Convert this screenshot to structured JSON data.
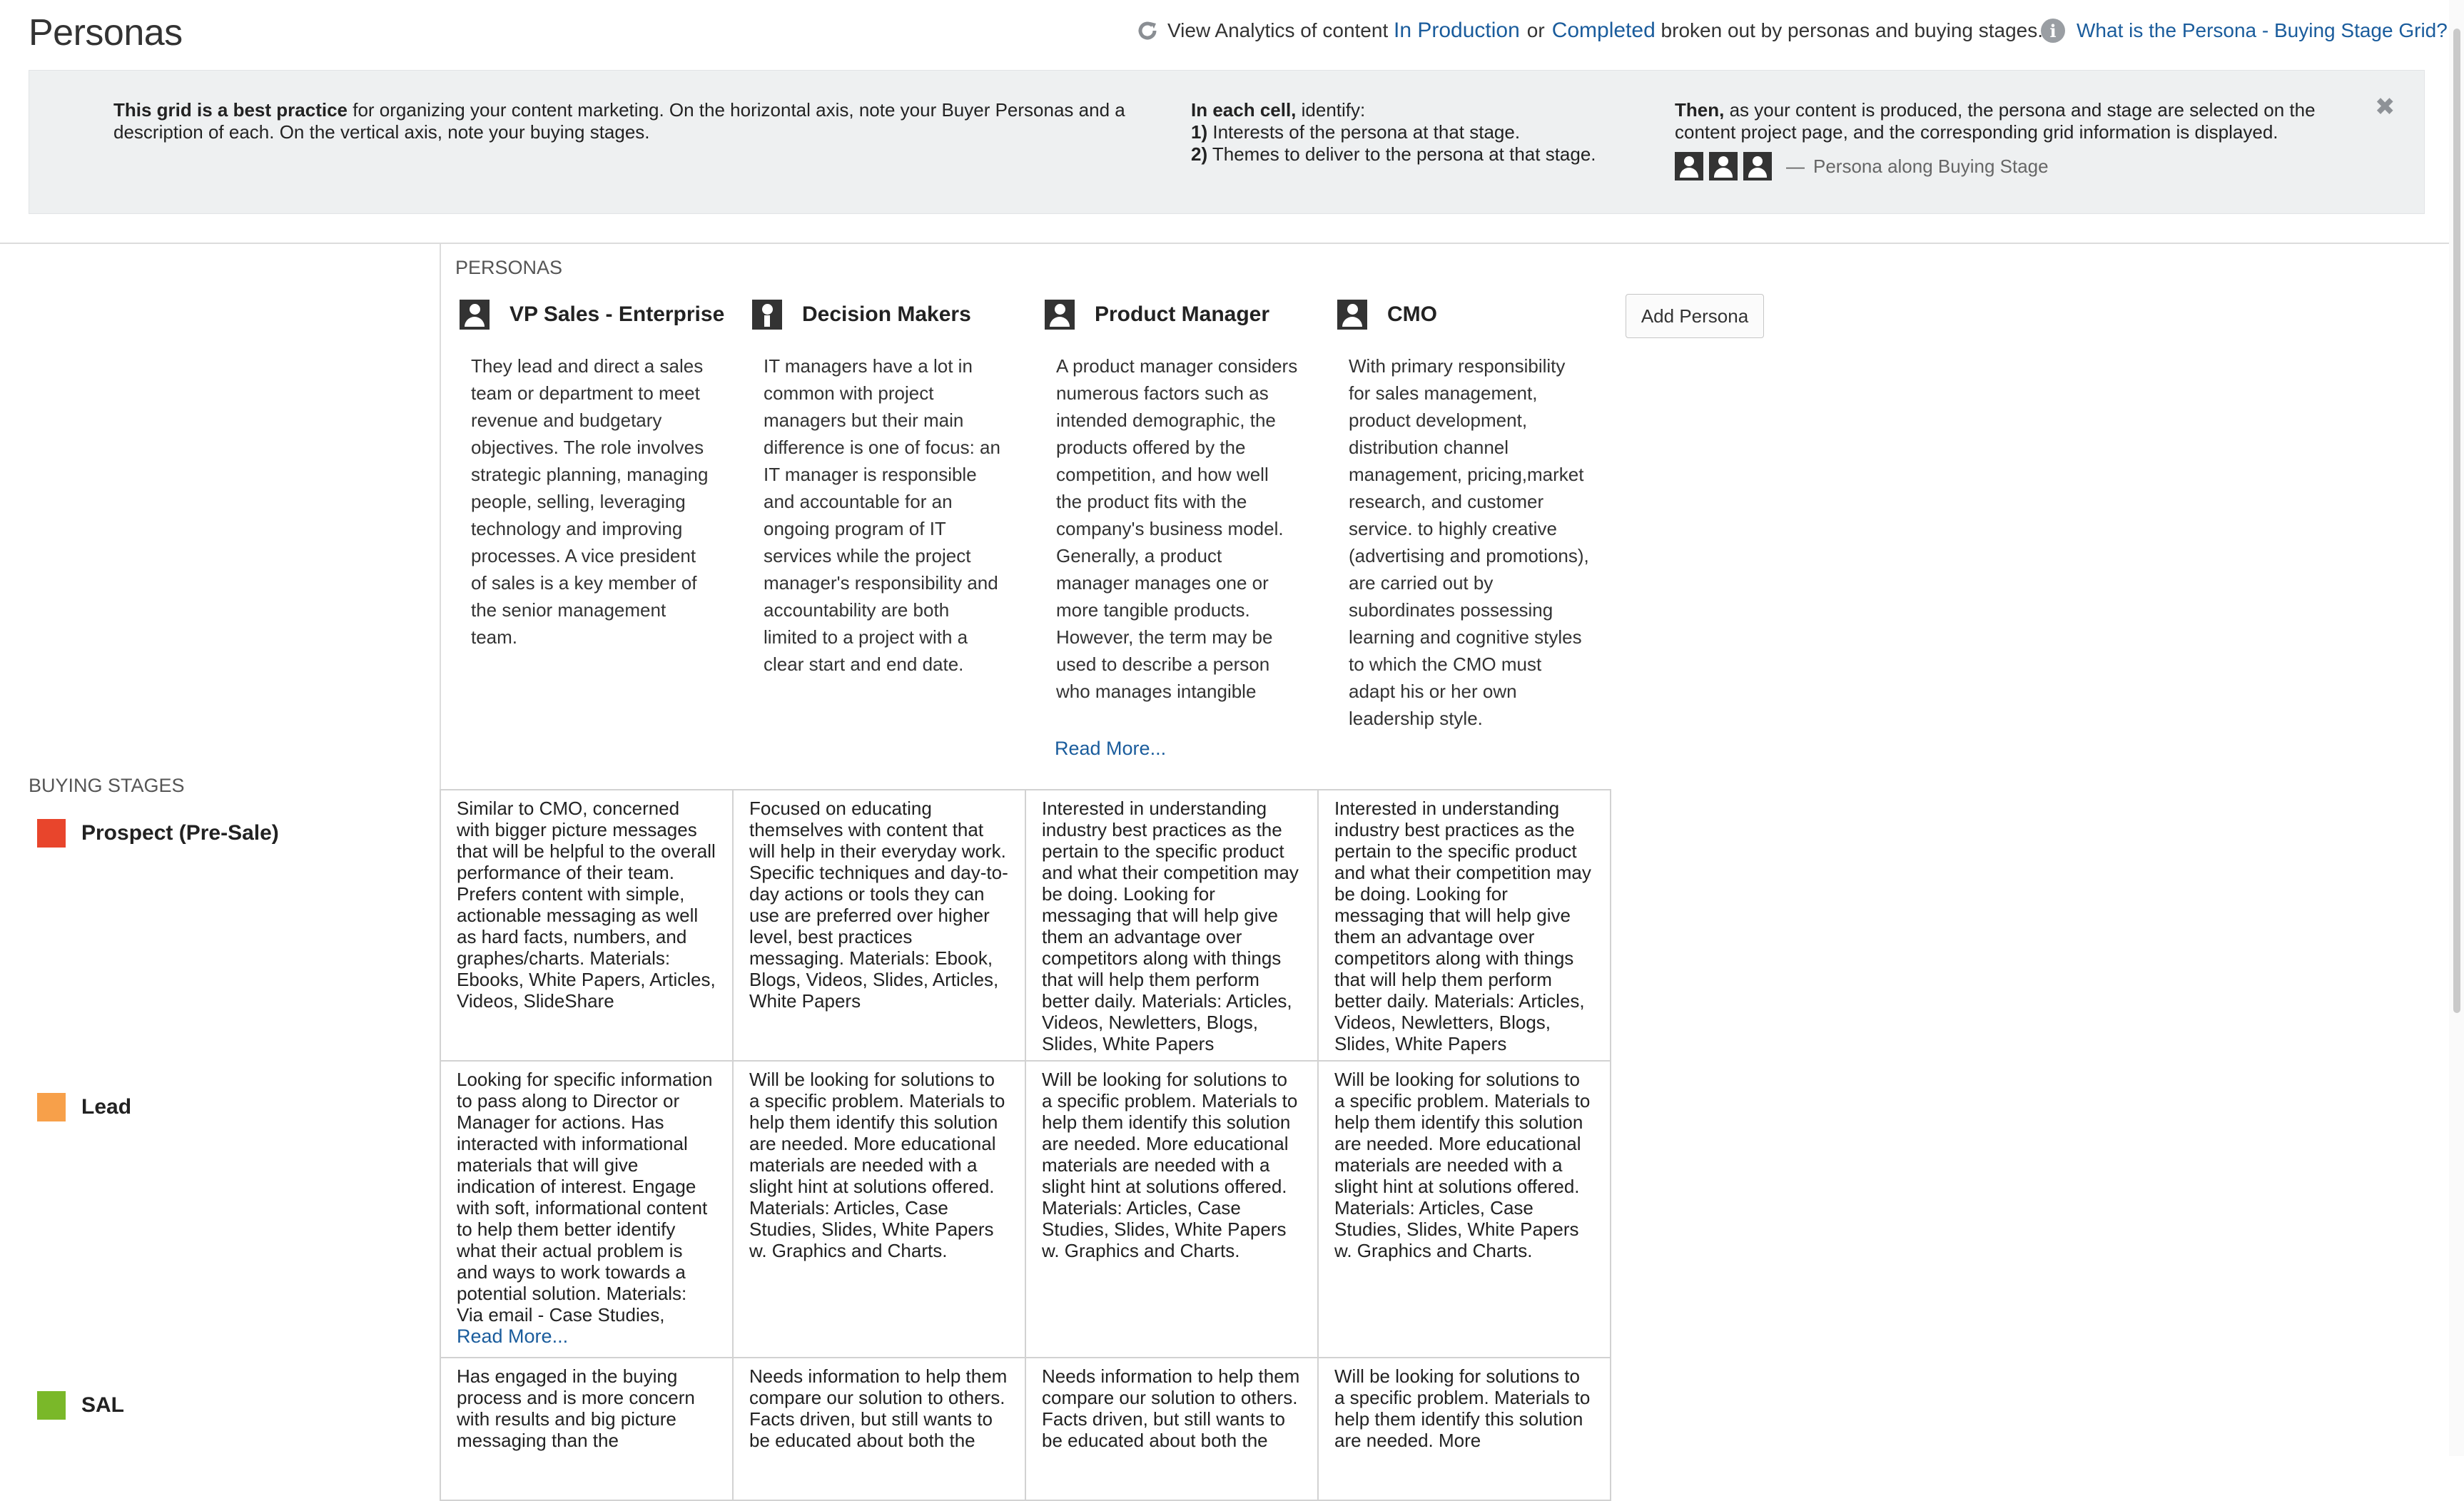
{
  "header": {
    "title": "Personas",
    "analytics_prefix": "View Analytics of content",
    "in_production": "In Production",
    "or": "or",
    "completed": "Completed",
    "analytics_suffix": "broken out by personas and buying stages.",
    "help_link": "What is the Persona - Buying Stage Grid?"
  },
  "panel": {
    "col1_bold": "This grid is a best practice",
    "col1_text": " for organizing your content marketing. On the horizontal axis, note your Buyer Personas and a description of each. On the vertical axis, note your buying stages.",
    "col2_bold": "In each cell,",
    "col2_text": " identify:",
    "col2_item1_num": "1)",
    "col2_item1": " Interests of the persona at that stage.",
    "col2_item2_num": "2)",
    "col2_item2": " Themes to deliver to the persona at that stage.",
    "col3_bold": "Then,",
    "col3_text": " as your content is produced, the persona and stage are selected on the content project page, and the corresponding grid information is displayed.",
    "legend_dash": "—",
    "legend_text": "Persona along Buying Stage"
  },
  "personas_label": "PERSONAS",
  "add_persona": "Add Persona",
  "read_more": "Read More...",
  "personas": [
    {
      "name": "VP Sales - Enterprise",
      "icon": "person-icon",
      "description": "They lead and direct a sales team or department to meet  revenue and budgetary objectives. The role involves strategic planning, managing people, selling, leveraging technology and improving processes.   A vice president of sales is a key member of the senior management team."
    },
    {
      "name": "Decision Makers",
      "icon": "person-tie-icon",
      "description": "IT managers have a lot in common with project managers but their main difference is one of focus: an IT manager is responsible and accountable for an ongoing program of IT services while the project manager's responsibility and accountability are both limited to a project with a clear start and end date."
    },
    {
      "name": "Product Manager",
      "icon": "person-icon",
      "description": "A product manager considers numerous factors such as intended demographic, the products offered by the competition, and how well the product fits with the company's business model. Generally, a product manager manages one or more tangible products. However, the term may be used to describe a person who manages intangible"
    },
    {
      "name": "CMO",
      "icon": "person-icon",
      "description": "With primary responsibility for sales management, product development, distribution channel management, pricing,market research, and customer service. to highly creative (advertising and promotions), are carried out by subordinates possessing learning and cognitive styles to which the CMO must adapt his or her own leadership style."
    }
  ],
  "stages_label": "BUYING STAGES",
  "stages": [
    {
      "name": "Prospect (Pre-Sale)",
      "color": "#e8452c"
    },
    {
      "name": "Lead",
      "color": "#f7a04a"
    },
    {
      "name": "SAL",
      "color": "#7ab829"
    }
  ],
  "grid": [
    [
      "Similar to CMO, concerned with bigger picture messages that will be helpful to the overall performance of their team. Prefers content with simple, actionable messaging as well as hard facts, numbers, and graphes/charts. Materials: Ebooks, White Papers, Articles, Videos, SlideShare",
      "Focused on educating themselves with content that will help in their everyday work. Specific techniques and day-to-day actions or tools they can use are preferred over higher level, best practices messaging. Materials: Ebook, Blogs, Videos, Slides, Articles, White Papers",
      "Interested in understanding industry best practices as the pertain to the specific product and what their competition may be doing. Looking for messaging that will help give them an advantage over competitors along with things that will help them perform better daily. Materials: Articles, Videos, Newletters, Blogs, Slides, White Papers",
      "Interested in understanding industry best practices as the pertain to the specific product and what their competition may be doing. Looking for messaging that will help give them an advantage over competitors along with things that will help them perform better daily. Materials: Articles, Videos, Newletters, Blogs, Slides, White Papers"
    ],
    [
      "Looking for specific information to pass along to Director or Manager for actions. Has interacted with informational materials that will give indication of interest. Engage with soft, informational content to help them better identify what their actual problem is and ways to work towards a potential solution. Materials: Via email - Case Studies,",
      "Will be looking for solutions to a specific problem. Materials to help them identify this solution are needed. More educational materials are needed with a slight hint at solutions offered. Materials: Articles, Case Studies, Slides, White Papers w. Graphics and Charts.",
      "Will be looking for solutions to a specific problem. Materials to help them identify this solution are needed. More educational materials are needed with a slight hint at solutions offered. Materials: Articles, Case Studies, Slides, White Papers w. Graphics and Charts.",
      "Will be looking for solutions to a specific problem. Materials to help them identify this solution are needed. More educational materials are needed with a slight hint at solutions offered. Materials: Articles, Case Studies, Slides, White Papers w. Graphics and Charts."
    ],
    [
      "Has engaged in the buying process and is more concern with results and big picture messaging than the",
      "Needs information to help them compare our solution to others. Facts driven, but still wants to be educated about both the",
      "Needs information to help them compare our solution to others. Facts driven, but still wants to be educated about both the",
      "Will be looking for solutions to a specific problem. Materials to help them identify this solution are needed. More"
    ]
  ]
}
